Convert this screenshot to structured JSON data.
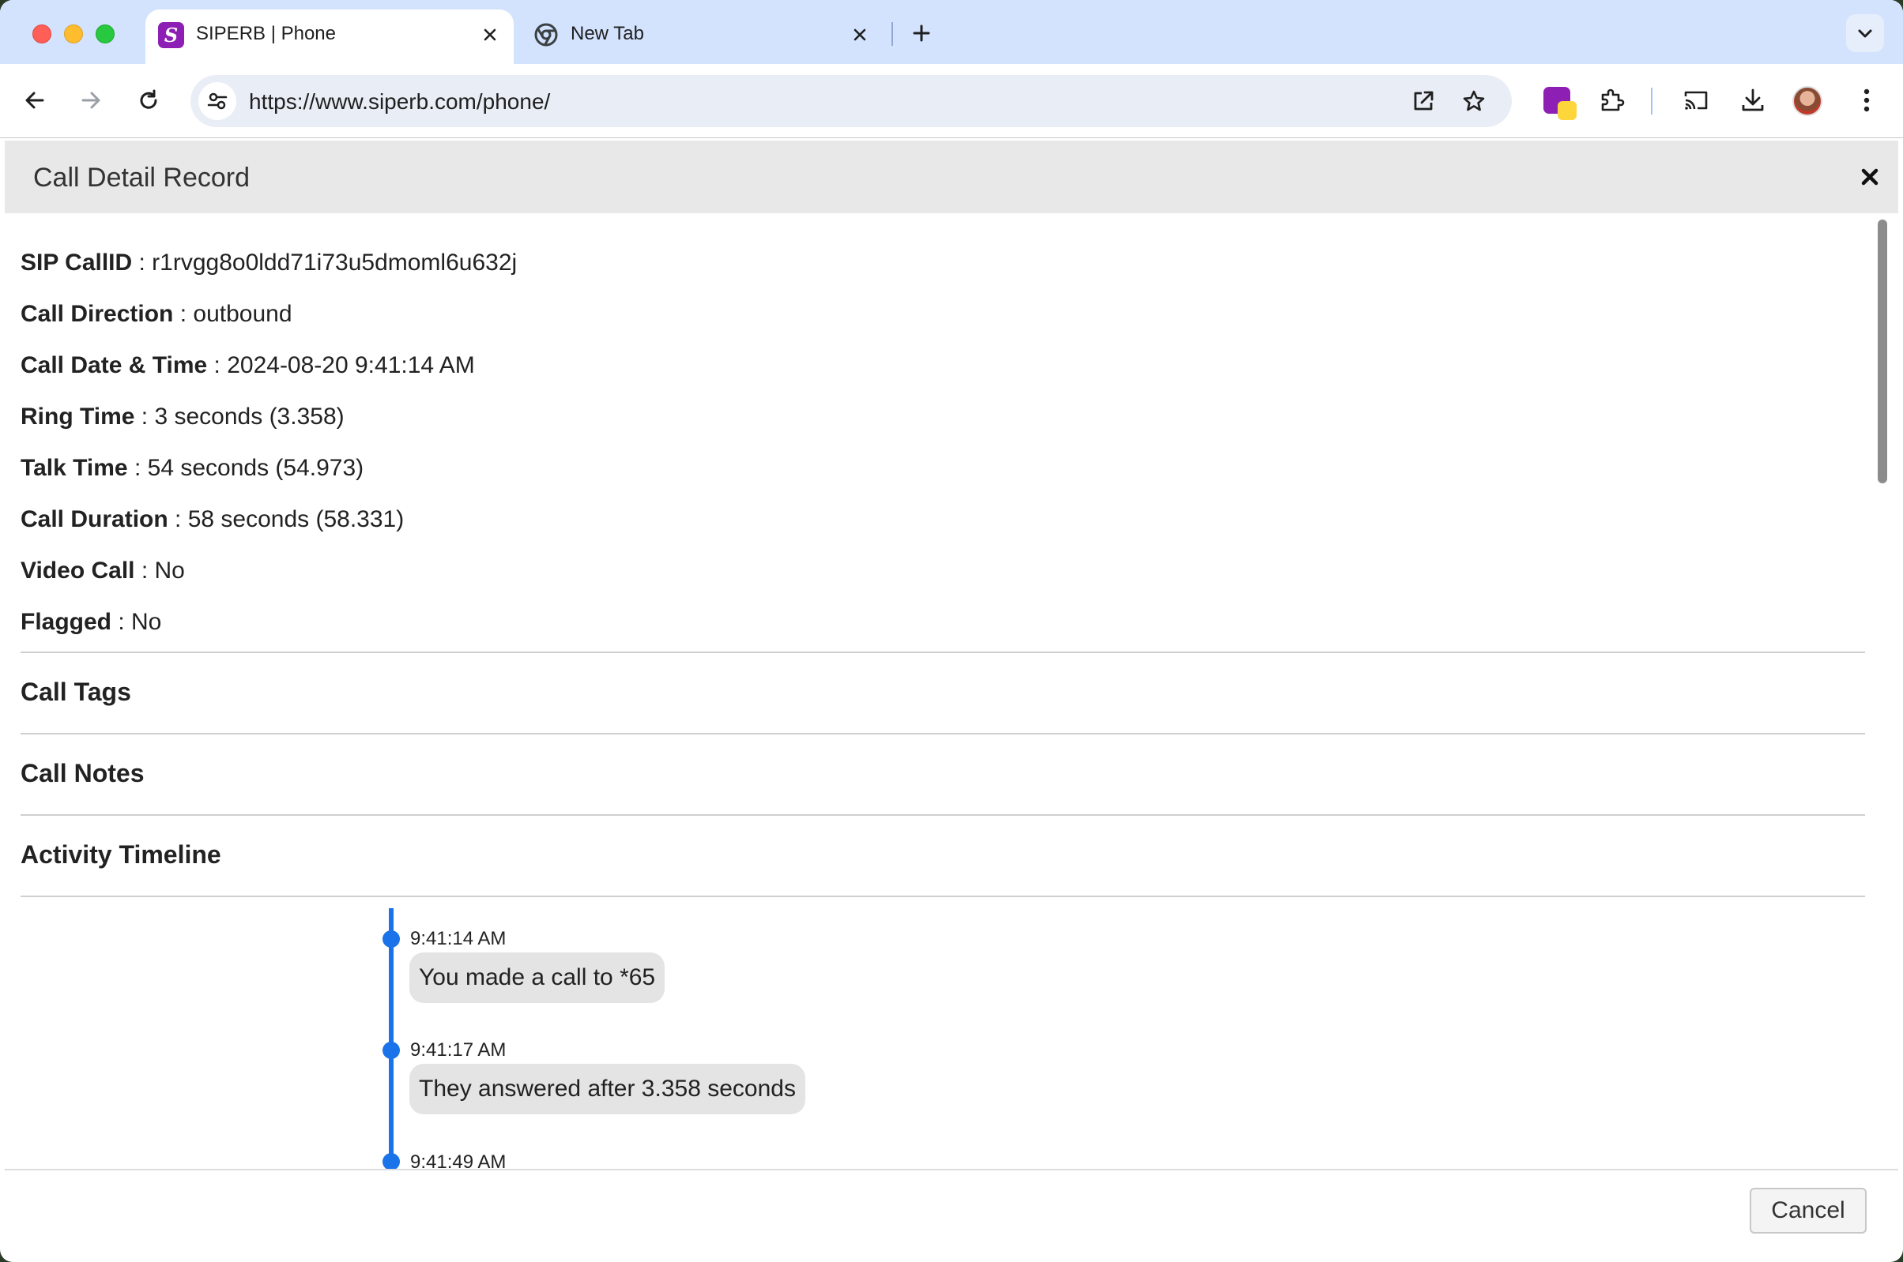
{
  "browser": {
    "tabs": [
      {
        "title": "SIPERB | Phone",
        "active": true,
        "favicon": "siperb-s-icon"
      },
      {
        "title": "New Tab",
        "active": false,
        "favicon": "chrome-icon"
      }
    ],
    "url": "https://www.siperb.com/phone/"
  },
  "modal": {
    "title": "Call Detail Record",
    "fields": [
      {
        "label": "SIP CallID",
        "value": " : r1rvgg8o0ldd71i73u5dmoml6u632j"
      },
      {
        "label": "Call Direction",
        "value": " : outbound"
      },
      {
        "label": "Call Date & Time",
        "value": " : 2024-08-20 9:41:14 AM"
      },
      {
        "label": "Ring Time",
        "value": " : 3 seconds (3.358)"
      },
      {
        "label": "Talk Time",
        "value": " : 54 seconds (54.973)"
      },
      {
        "label": "Call Duration",
        "value": " : 58 seconds (58.331)"
      },
      {
        "label": "Video Call",
        "value": " : No"
      },
      {
        "label": "Flagged",
        "value": " : No"
      }
    ],
    "sections": [
      "Call Tags",
      "Call Notes",
      "Activity Timeline"
    ],
    "timeline": [
      {
        "time": "9:41:14 AM",
        "text": "You made a call to *65"
      },
      {
        "time": "9:41:17 AM",
        "text": "They answered after 3.358 seconds"
      },
      {
        "time": "9:41:49 AM",
        "text": ""
      }
    ],
    "cancel_label": "Cancel"
  },
  "colors": {
    "accent": "#1a73e8",
    "tabstrip": "#d3e3fd",
    "siperb_brand": "#8d1fb5"
  }
}
